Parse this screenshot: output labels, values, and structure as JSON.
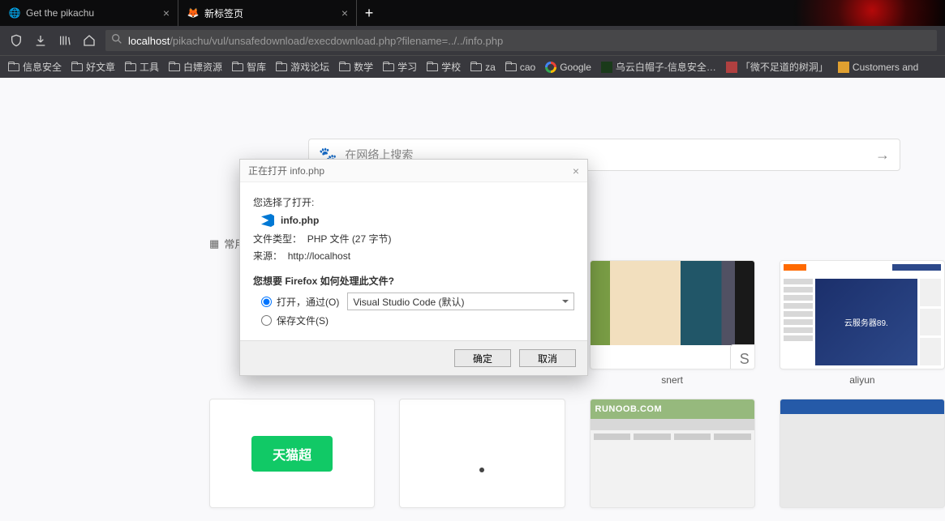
{
  "tabs": [
    {
      "title": "Get the pikachu",
      "active": false
    },
    {
      "title": "新标签页",
      "active": true
    }
  ],
  "url": {
    "visible_prefix": "localhost",
    "visible_suffix": "/pikachu/vul/unsafedownload/execdownload.php?filename=../../info.php"
  },
  "bookmarks": [
    {
      "label": "信息安全",
      "icon": "folder"
    },
    {
      "label": "好文章",
      "icon": "folder"
    },
    {
      "label": "工具",
      "icon": "folder"
    },
    {
      "label": "白嫖资源",
      "icon": "folder"
    },
    {
      "label": "智库",
      "icon": "folder"
    },
    {
      "label": "游戏论坛",
      "icon": "folder"
    },
    {
      "label": "数学",
      "icon": "folder"
    },
    {
      "label": "学习",
      "icon": "folder"
    },
    {
      "label": "学校",
      "icon": "folder"
    },
    {
      "label": "za",
      "icon": "folder"
    },
    {
      "label": "cao",
      "icon": "folder"
    },
    {
      "label": "Google",
      "icon": "google"
    },
    {
      "label": "乌云白帽子-信息安全…",
      "icon": "wy"
    },
    {
      "label": "「微不足道的树洞」",
      "icon": "red"
    },
    {
      "label": "Customers and",
      "icon": "yellow"
    }
  ],
  "search": {
    "placeholder": "在网络上搜索"
  },
  "section_label": "常用",
  "tiles": {
    "row1": [
      {
        "label": ""
      },
      {
        "label": ""
      },
      {
        "label": "snert",
        "badge": "S"
      },
      {
        "label": "aliyun",
        "banner_cn": "云服务器89."
      }
    ],
    "row2": [
      {
        "label": "",
        "logo_text": "天猫超"
      },
      {
        "label": ""
      },
      {
        "label": "",
        "brand": "RUNOOB.COM"
      },
      {
        "label": ""
      }
    ]
  },
  "dialog": {
    "title": "正在打开 info.php",
    "chosen_open": "您选择了打开:",
    "filename": "info.php",
    "type_label": "文件类型：",
    "type_value": "PHP 文件 (27 字节)",
    "source_label": "来源：",
    "source_value": "http://localhost",
    "how_handle": "您想要 Firefox 如何处理此文件?",
    "opt_open": "打开，通过(O)",
    "opt_open_app": "Visual Studio Code (默认)",
    "opt_save": "保存文件(S)",
    "btn_ok": "确定",
    "btn_cancel": "取消"
  }
}
